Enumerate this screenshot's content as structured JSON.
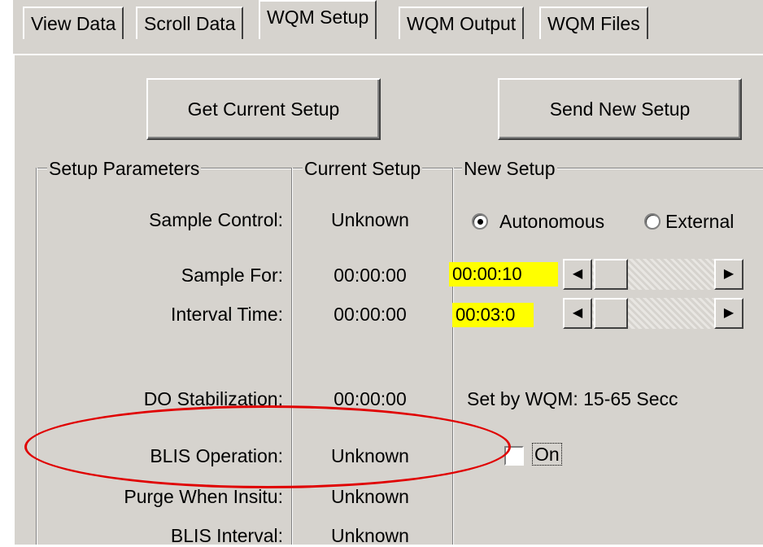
{
  "tabs": [
    {
      "label": "View Data"
    },
    {
      "label": "Scroll Data"
    },
    {
      "label": "WQM Setup"
    },
    {
      "label": "WQM Output"
    },
    {
      "label": "WQM Files"
    }
  ],
  "buttons": {
    "get_current": "Get Current Setup",
    "send_new": "Send New Setup"
  },
  "groups": {
    "setup_parameters": "Setup Parameters",
    "current_setup": "Current Setup",
    "new_setup": "New Setup"
  },
  "rows": {
    "sample_control": {
      "label": "Sample Control:",
      "current": "Unknown"
    },
    "sample_for": {
      "label": "Sample For:",
      "current": "00:00:00",
      "new_value": "00:00:10"
    },
    "interval_time": {
      "label": "Interval Time:",
      "current": "00:00:00",
      "new_value": "00:03:0"
    },
    "do_stabilization": {
      "label": "DO Stabilization:",
      "current": "00:00:00",
      "new_text": "Set by WQM: 15-65 Secc"
    },
    "blis_operation": {
      "label": "BLIS Operation:",
      "current": "Unknown",
      "checkbox_label": "On",
      "checked": false
    },
    "purge_when_insitu": {
      "label": "Purge When Insitu:",
      "current": "Unknown"
    },
    "blis_interval": {
      "label": "BLIS Interval:",
      "current": "Unknown"
    }
  },
  "sample_control_options": {
    "autonomous": "Autonomous",
    "external": "External",
    "selected": "Autonomous"
  },
  "sliders": {
    "sample_for": {
      "position": 0.05
    },
    "interval_time": {
      "position": 0.05
    }
  },
  "colors": {
    "background": "#d6d3ce",
    "highlight_field": "#ffff00",
    "annotation": "#e00000"
  }
}
